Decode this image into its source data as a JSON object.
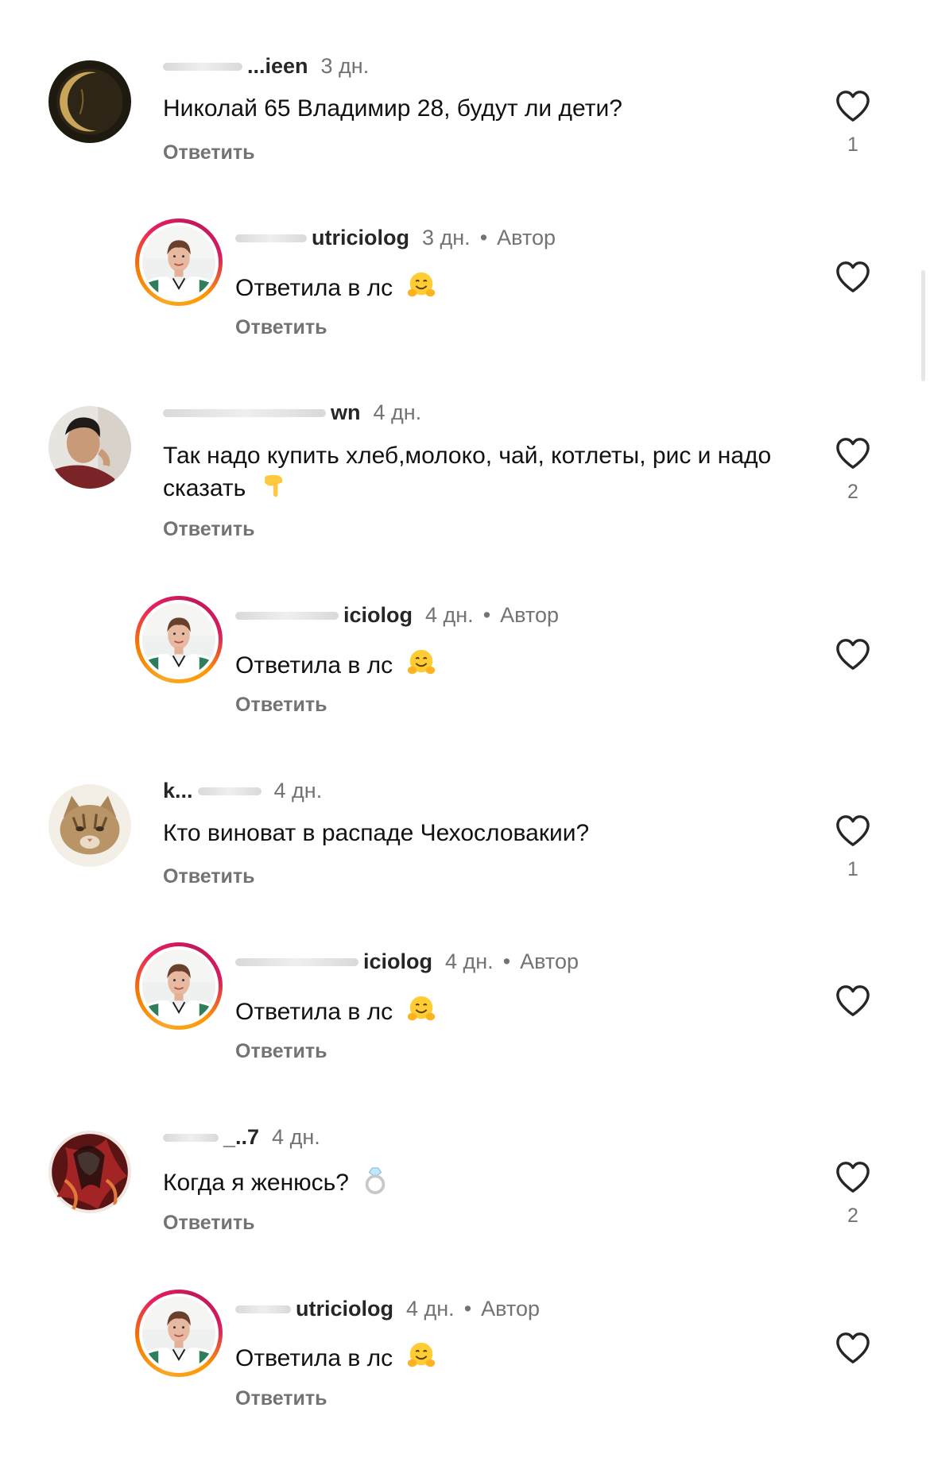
{
  "comments": [
    {
      "user_visible": "...ieen",
      "time": "3 дн.",
      "text": "Николай 65 Владимир 28, будут ли дети?",
      "reply": "Ответить",
      "likes": "1",
      "avatar": "moon-avatar"
    },
    {
      "user_visible": "utriciolog",
      "time": "3 дн.",
      "author": "Автор",
      "text": "Ответила в лс",
      "reply": "Ответить",
      "avatar": "nutritionist-avatar",
      "emoji": "hugging-face-icon"
    },
    {
      "user_visible": "wn",
      "time": "4 дн.",
      "text": "Так надо купить хлеб,молоко, чай, котлеты, рис и надо сказать",
      "reply": "Ответить",
      "likes": "2",
      "avatar": "man-avatar",
      "emoji": "pointing-down-icon"
    },
    {
      "user_visible": "iciolog",
      "time": "4 дн.",
      "author": "Автор",
      "text": "Ответила в лс",
      "reply": "Ответить",
      "avatar": "nutritionist-avatar",
      "emoji": "hugging-face-icon"
    },
    {
      "user_visible": "k...",
      "time": "4 дн.",
      "text": "Кто виноват в распаде Чехословакии?",
      "reply": "Ответить",
      "likes": "1",
      "avatar": "cat-avatar"
    },
    {
      "user_visible": "iciolog",
      "time": "4 дн.",
      "author": "Автор",
      "text": "Ответила в лс",
      "reply": "Ответить",
      "avatar": "nutritionist-avatar",
      "emoji": "hugging-face-icon"
    },
    {
      "user_visible": "_..7",
      "time": "4 дн.",
      "text": "Когда я женюсь?",
      "reply": "Ответить",
      "likes": "2",
      "avatar": "anime-avatar",
      "emoji": "ring-icon"
    },
    {
      "user_visible": "utriciolog",
      "time": "4 дн.",
      "author": "Автор",
      "text": "Ответила в лс",
      "reply": "Ответить",
      "avatar": "nutritionist-avatar",
      "emoji": "hugging-face-icon"
    }
  ],
  "colors": {
    "secondary_text": "#737373",
    "primary_text": "#111111",
    "story_ring": "#e91e63"
  }
}
